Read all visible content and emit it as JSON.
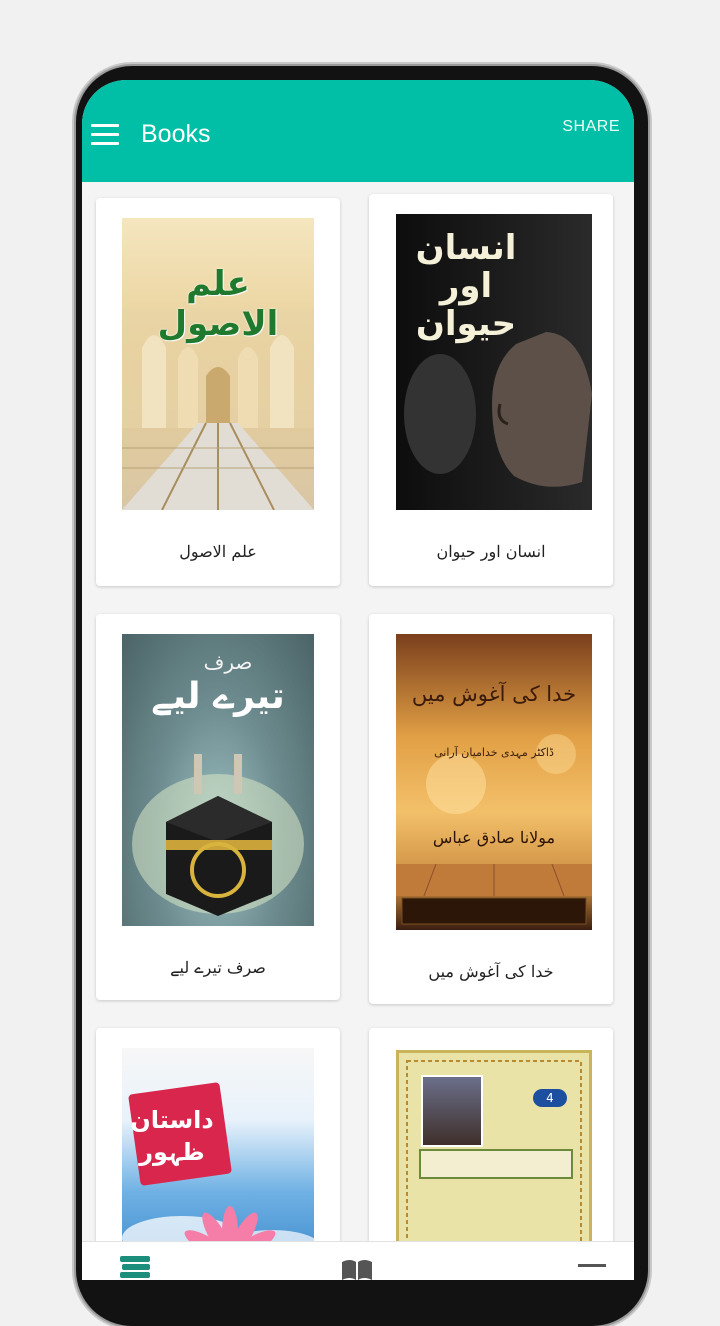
{
  "app": {
    "title": "Books",
    "share_label": "SHARE",
    "accent_color": "#00bfa6"
  },
  "books": [
    {
      "title": "علم الاصول",
      "cover_text": "علم الاصول"
    },
    {
      "title": "انسان اور حیوان",
      "cover_lines": [
        "انسان",
        "اور",
        "حیوان"
      ]
    },
    {
      "title": "صرف تیرے لیے",
      "cover_small": "صرف",
      "cover_big": "تیرے لیے"
    },
    {
      "title": "خدا کی آغوش میں",
      "cover_title": "خدا کی آغوش میں",
      "cover_author": "ڈاکٹر مہدی خدامیان آرانی",
      "cover_translator": "مولانا صادق عباس"
    },
    {
      "title": "",
      "cover_lines": [
        "داستان",
        "ظہور"
      ]
    },
    {
      "title": "",
      "badge": "4"
    }
  ],
  "bottom_nav": {
    "items": [
      "books-icon",
      "library-icon",
      "menu-icon"
    ]
  }
}
